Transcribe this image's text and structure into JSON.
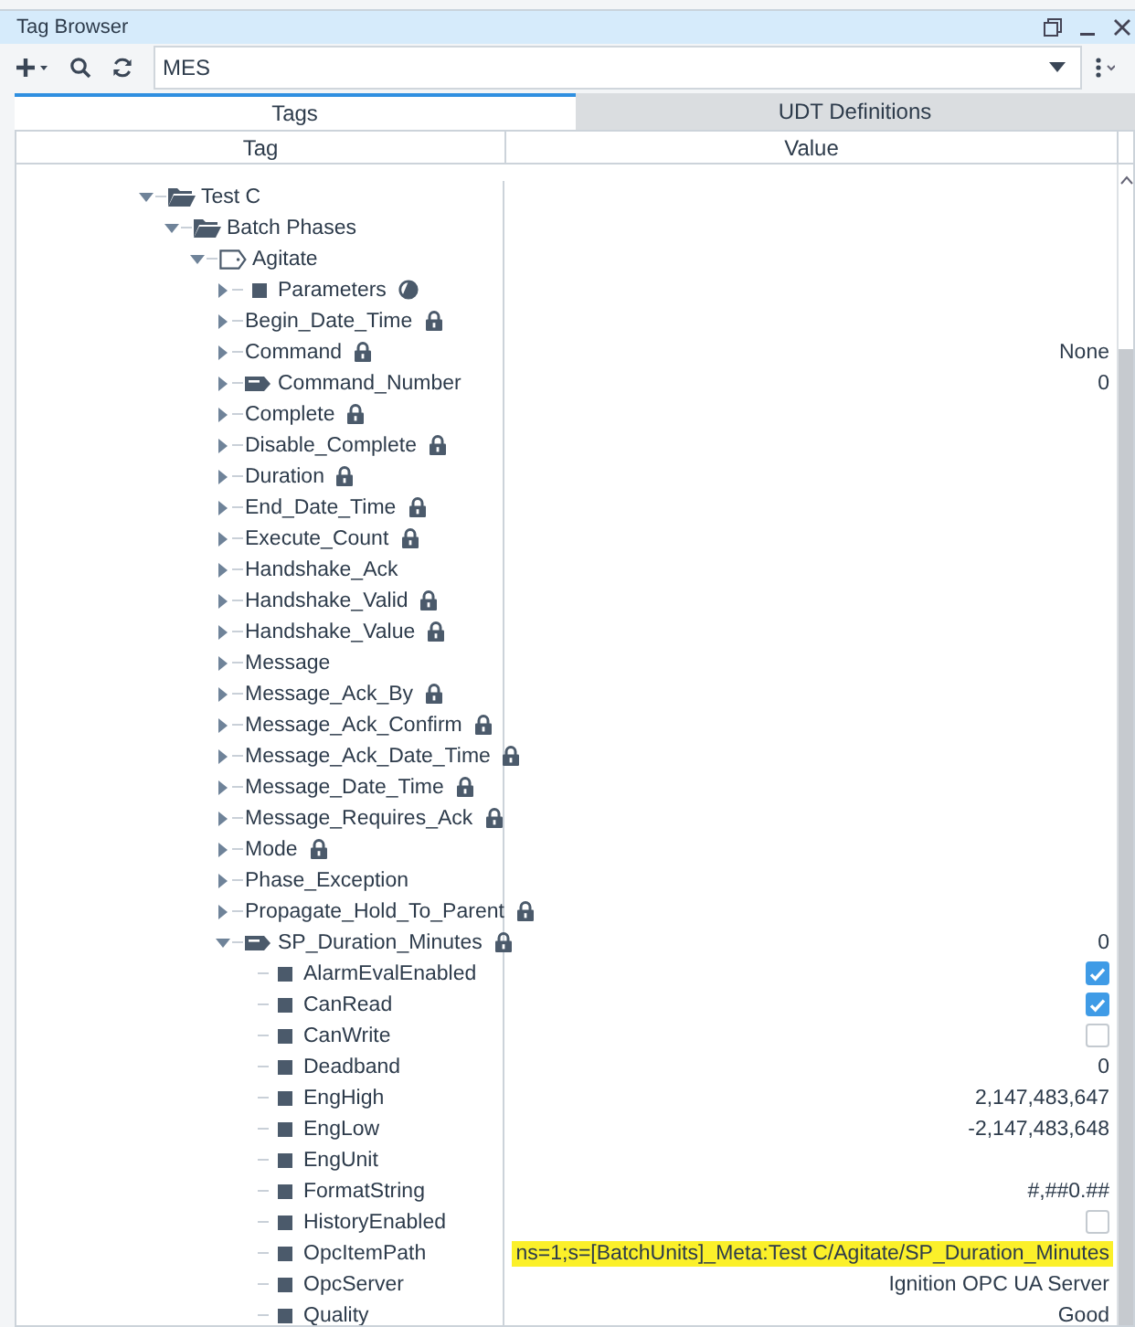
{
  "window": {
    "title": "Tag Browser"
  },
  "toolbar": {
    "provider": "MES"
  },
  "tabs": [
    {
      "label": "Tags",
      "selected": true
    },
    {
      "label": "UDT Definitions",
      "selected": false
    }
  ],
  "columns": [
    "Tag",
    "Value"
  ],
  "tree": [
    {
      "label": "Test C",
      "kind": "folder",
      "expanded": true,
      "children": [
        {
          "label": "Batch Phases",
          "kind": "folder",
          "expanded": true,
          "children": [
            {
              "label": "Agitate",
              "kind": "udt",
              "expanded": true,
              "children": [
                {
                  "label": "Parameters",
                  "kind": "block",
                  "expanded": false,
                  "locked": false,
                  "partial": true
                },
                {
                  "label": "Begin_Date_Time",
                  "kind": "plain",
                  "expanded": false,
                  "locked": true
                },
                {
                  "label": "Command",
                  "kind": "plain",
                  "expanded": false,
                  "locked": true,
                  "value": "None"
                },
                {
                  "label": "Command_Number",
                  "kind": "opc",
                  "expanded": false,
                  "locked": false,
                  "value": "0"
                },
                {
                  "label": "Complete",
                  "kind": "plain",
                  "expanded": false,
                  "locked": true
                },
                {
                  "label": "Disable_Complete",
                  "kind": "plain",
                  "expanded": false,
                  "locked": true
                },
                {
                  "label": "Duration",
                  "kind": "plain",
                  "expanded": false,
                  "locked": true
                },
                {
                  "label": "End_Date_Time",
                  "kind": "plain",
                  "expanded": false,
                  "locked": true
                },
                {
                  "label": "Execute_Count",
                  "kind": "plain",
                  "expanded": false,
                  "locked": true
                },
                {
                  "label": "Handshake_Ack",
                  "kind": "plain",
                  "expanded": false,
                  "locked": false
                },
                {
                  "label": "Handshake_Valid",
                  "kind": "plain",
                  "expanded": false,
                  "locked": true
                },
                {
                  "label": "Handshake_Value",
                  "kind": "plain",
                  "expanded": false,
                  "locked": true
                },
                {
                  "label": "Message",
                  "kind": "plain",
                  "expanded": false,
                  "locked": false
                },
                {
                  "label": "Message_Ack_By",
                  "kind": "plain",
                  "expanded": false,
                  "locked": true
                },
                {
                  "label": "Message_Ack_Confirm",
                  "kind": "plain",
                  "expanded": false,
                  "locked": true
                },
                {
                  "label": "Message_Ack_Date_Time",
                  "kind": "plain",
                  "expanded": false,
                  "locked": true
                },
                {
                  "label": "Message_Date_Time",
                  "kind": "plain",
                  "expanded": false,
                  "locked": true
                },
                {
                  "label": "Message_Requires_Ack",
                  "kind": "plain",
                  "expanded": false,
                  "locked": true
                },
                {
                  "label": "Mode",
                  "kind": "plain",
                  "expanded": false,
                  "locked": true
                },
                {
                  "label": "Phase_Exception",
                  "kind": "plain",
                  "expanded": false,
                  "locked": false
                },
                {
                  "label": "Propagate_Hold_To_Parent",
                  "kind": "plain",
                  "expanded": false,
                  "locked": true
                },
                {
                  "label": "SP_Duration_Minutes",
                  "kind": "opc",
                  "expanded": true,
                  "locked": true,
                  "value": "0",
                  "children": [
                    {
                      "label": "AlarmEvalEnabled",
                      "kind": "property",
                      "checked": true
                    },
                    {
                      "label": "CanRead",
                      "kind": "property",
                      "checked": true
                    },
                    {
                      "label": "CanWrite",
                      "kind": "property",
                      "checked": false
                    },
                    {
                      "label": "Deadband",
                      "kind": "property",
                      "value": "0"
                    },
                    {
                      "label": "EngHigh",
                      "kind": "property",
                      "value": "2,147,483,647"
                    },
                    {
                      "label": "EngLow",
                      "kind": "property",
                      "value": "-2,147,483,648"
                    },
                    {
                      "label": "EngUnit",
                      "kind": "property"
                    },
                    {
                      "label": "FormatString",
                      "kind": "property",
                      "value": "#,##0.##"
                    },
                    {
                      "label": "HistoryEnabled",
                      "kind": "property",
                      "checked": false
                    },
                    {
                      "label": "OpcItemPath",
                      "kind": "property",
                      "value": "ns=1;s=[BatchUnits]_Meta:Test C/Agitate/SP_Duration_Minutes",
                      "highlighted": true
                    },
                    {
                      "label": "OpcServer",
                      "kind": "property",
                      "value": "Ignition OPC UA Server"
                    },
                    {
                      "label": "Quality",
                      "kind": "property",
                      "value": "Good"
                    }
                  ]
                }
              ]
            }
          ]
        }
      ]
    }
  ]
}
